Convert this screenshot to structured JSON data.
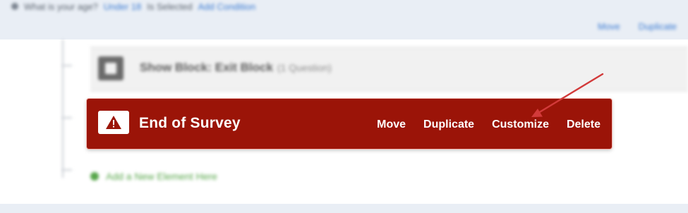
{
  "condition": {
    "question": "What is your age?",
    "value": "Under 18",
    "status": "Is Selected",
    "add_condition": "Add Condition"
  },
  "branch_actions": {
    "move": "Move",
    "duplicate": "Duplicate"
  },
  "show_block": {
    "title": "Show Block: Exit Block",
    "count": "(1 Question)"
  },
  "end_of_survey": {
    "icon": "warning-icon",
    "title": "End of Survey",
    "actions": [
      "Move",
      "Duplicate",
      "Customize",
      "Delete"
    ]
  },
  "add_element": {
    "label": "Add a New Element Here"
  },
  "colors": {
    "eos_background": "#9b1408",
    "annotation_arrow": "#d23a3a",
    "link": "#3b7bd2",
    "add_green": "#57a64a"
  }
}
